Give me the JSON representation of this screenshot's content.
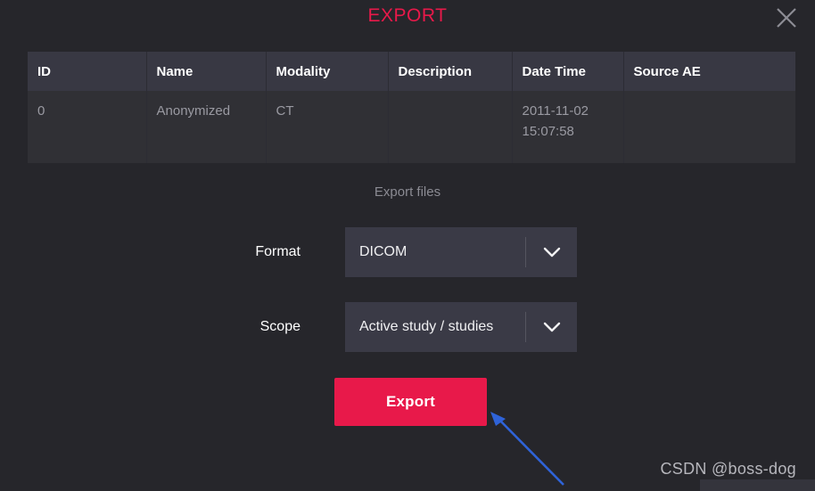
{
  "dialog": {
    "title": "EXPORT",
    "close_icon": "close-icon"
  },
  "table": {
    "columns": [
      "ID",
      "Name",
      "Modality",
      "Description",
      "Date Time",
      "Source AE"
    ],
    "rows": [
      {
        "id": "0",
        "name": "Anonymized",
        "modality": "CT",
        "description": "",
        "date_time": "2011-11-02 15:07:58",
        "source_ae": ""
      }
    ]
  },
  "section": {
    "label": "Export files"
  },
  "form": {
    "format": {
      "label": "Format",
      "value": "DICOM",
      "chevron_icon": "chevron-down-icon"
    },
    "scope": {
      "label": "Scope",
      "value": "Active study / studies",
      "chevron_icon": "chevron-down-icon"
    }
  },
  "actions": {
    "export_label": "Export"
  },
  "annotation": {
    "arrow_icon": "arrow-up-left-icon",
    "arrow_color": "#2f63d8"
  },
  "watermark": {
    "text": "CSDN @boss-dog"
  },
  "colors": {
    "background": "#26262b",
    "accent": "#e8194a",
    "table_header": "#383843",
    "table_row": "#303035",
    "select_background": "#3a3a46"
  }
}
